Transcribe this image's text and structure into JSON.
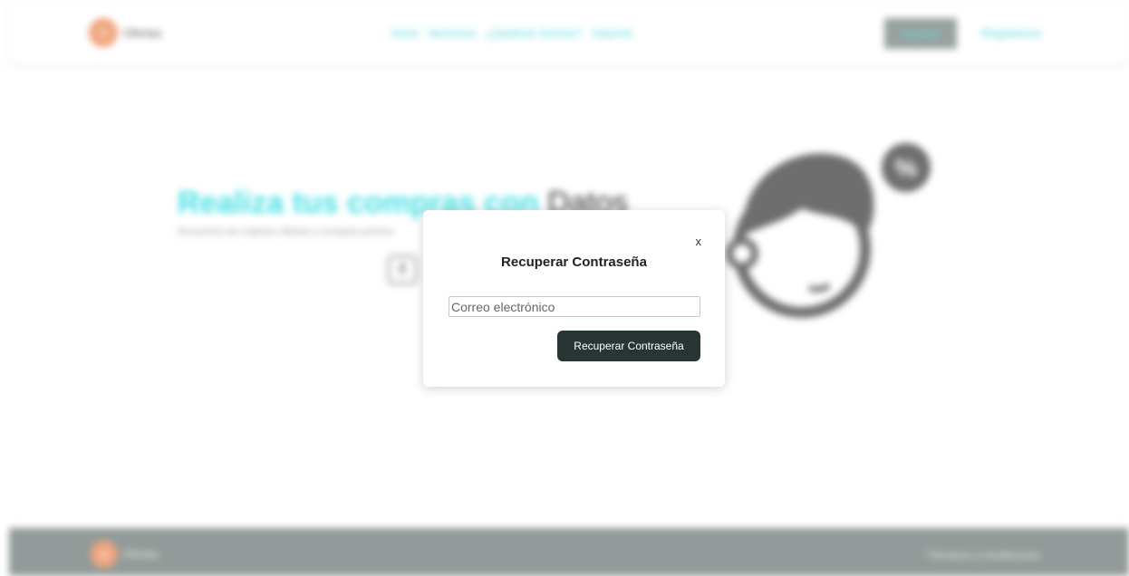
{
  "header": {
    "brand_letter": "O",
    "brand_name": "Ofertas",
    "nav_links": [
      "Inicio",
      "Servicios",
      "¿Quiénes Somos?",
      "Soporte"
    ],
    "login_label": "Ingresar",
    "register_label": "Registrarse"
  },
  "hero": {
    "title_accent": "Realiza tus compras con ",
    "title_dark": "Datos",
    "subtitle": "Encuentra las mejores ofertas y compara precios",
    "social_icon": "facebook-icon"
  },
  "modal": {
    "close_label": "x",
    "title": "Recuperar Contraseña",
    "email_placeholder": "Correo electrónico",
    "email_value": "",
    "submit_label": "Recuperar Contraseña"
  },
  "footer": {
    "brand_letter": "O",
    "brand_name": "Ofertas",
    "terms_label": "Términos y condiciones"
  },
  "colors": {
    "accent": "#48e0e4",
    "brand_orange": "#f0a47c",
    "button_dark": "#283535",
    "footer_bg": "#929b99"
  }
}
